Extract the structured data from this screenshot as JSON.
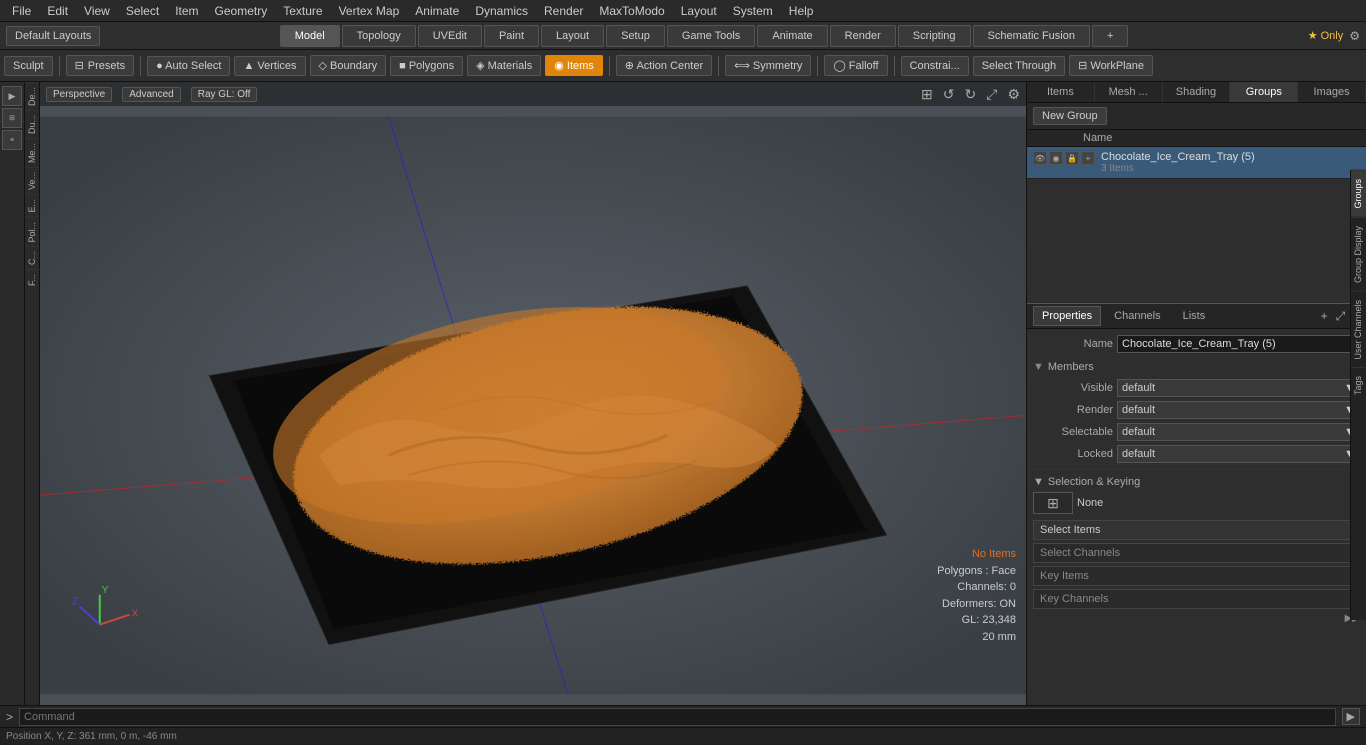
{
  "menu": {
    "items": [
      "File",
      "Edit",
      "View",
      "Select",
      "Item",
      "Geometry",
      "Texture",
      "Vertex Map",
      "Animate",
      "Dynamics",
      "Render",
      "MaxToModo",
      "Layout",
      "System",
      "Help"
    ]
  },
  "layout_bar": {
    "left_label": "Default Layouts",
    "tabs": [
      "Model",
      "Topology",
      "UVEdit",
      "Paint",
      "Layout",
      "Setup",
      "Game Tools",
      "Animate",
      "Render",
      "Scripting",
      "Schematic Fusion"
    ],
    "active_tab": "Model",
    "right_label": "★ Only"
  },
  "toolbar": {
    "sculpt_label": "Sculpt",
    "presets_label": "Presets",
    "tools": [
      {
        "label": "Auto Select",
        "icon": "●",
        "active": false
      },
      {
        "label": "Vertices",
        "icon": "▲",
        "active": false
      },
      {
        "label": "Boundary",
        "icon": "◇",
        "active": false
      },
      {
        "label": "Polygons",
        "icon": "■",
        "active": false
      },
      {
        "label": "Materials",
        "icon": "◈",
        "active": false
      },
      {
        "label": "Items",
        "icon": "◉",
        "active": true
      },
      {
        "label": "Action Center",
        "icon": "⊕",
        "active": false
      },
      {
        "label": "Symmetry",
        "icon": "⟺",
        "active": false
      },
      {
        "label": "Falloff",
        "icon": "◯",
        "active": false
      },
      {
        "label": "Constrai...",
        "icon": "",
        "active": false
      },
      {
        "label": "Select Through",
        "icon": "",
        "active": false
      },
      {
        "label": "WorkPlane",
        "icon": "⊟",
        "active": false
      }
    ]
  },
  "viewport": {
    "mode": "Perspective",
    "style": "Advanced",
    "render": "Ray GL: Off",
    "overlay_text": {
      "no_items": "No Items",
      "polygons": "Polygons : Face",
      "channels": "Channels: 0",
      "deformers": "Deformers: ON",
      "gl": "GL: 23,348",
      "mm": "20 mm"
    },
    "position": "Position X, Y, Z:  361 mm, 0 m, -46 mm"
  },
  "right_panel": {
    "tabs": [
      "Items",
      "Mesh ...",
      "Shading",
      "Groups",
      "Images"
    ],
    "active_tab": "Groups",
    "new_group_btn": "New Group",
    "name_col": "Name",
    "group": {
      "name": "Chocolate_Ice_Cream_Tray (5)",
      "sub": "3 Items"
    }
  },
  "properties": {
    "tabs": [
      "Properties",
      "Channels",
      "Lists"
    ],
    "active_tab": "Properties",
    "add_btn": "+",
    "name_label": "Name",
    "name_value": "Chocolate_Ice_Cream_Tray (5)",
    "members_section": "Members",
    "fields": [
      {
        "label": "Visible",
        "value": "default"
      },
      {
        "label": "Render",
        "value": "default"
      },
      {
        "label": "Selectable",
        "value": "default"
      },
      {
        "label": "Locked",
        "value": "default"
      }
    ]
  },
  "selection_keying": {
    "title": "Selection & Keying",
    "icon_label": "None",
    "buttons": [
      {
        "label": "Select Items",
        "active": true
      },
      {
        "label": "Select Channels",
        "active": false
      },
      {
        "label": "Key Items",
        "active": false
      },
      {
        "label": "Key Channels",
        "active": false
      }
    ]
  },
  "right_vtabs": [
    "Groups",
    "Group Display",
    "User Channels",
    "Tags"
  ],
  "command_bar": {
    "arrow": ">",
    "placeholder": "Command",
    "btn_label": "▶"
  },
  "status_bar": {
    "position": "Position X, Y, Z:  361 mm, 0 m, -46 mm"
  },
  "left_labels": [
    "De...",
    "Du...",
    "Me...",
    "Ve...",
    "E...",
    "Pol...",
    "C...",
    "F..."
  ]
}
